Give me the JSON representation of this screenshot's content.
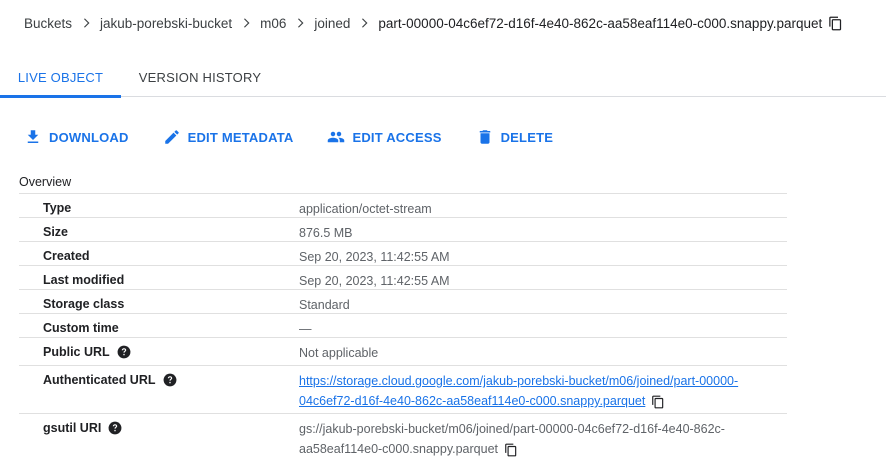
{
  "breadcrumb": {
    "items": [
      "Buckets",
      "jakub-porebski-bucket",
      "m06",
      "joined"
    ],
    "current": "part-00000-04c6ef72-d16f-4e40-862c-aa58eaf114e0-c000.snappy.parquet"
  },
  "tabs": [
    {
      "label": "LIVE OBJECT",
      "active": true
    },
    {
      "label": "VERSION HISTORY",
      "active": false
    }
  ],
  "toolbar": {
    "download": "DOWNLOAD",
    "edit_metadata": "EDIT METADATA",
    "edit_access": "EDIT ACCESS",
    "delete": "DELETE"
  },
  "details": {
    "section": "Overview",
    "type": {
      "label": "Type",
      "value": "application/octet-stream"
    },
    "size": {
      "label": "Size",
      "value": "876.5 MB"
    },
    "created": {
      "label": "Created",
      "value": "Sep 20, 2023, 11:42:55 AM"
    },
    "last_modified": {
      "label": "Last modified",
      "value": "Sep 20, 2023, 11:42:55 AM"
    },
    "storage_class": {
      "label": "Storage class",
      "value": "Standard"
    },
    "custom_time": {
      "label": "Custom time",
      "value": "—"
    },
    "public_url": {
      "label": "Public URL",
      "value": "Not applicable"
    },
    "authenticated_url": {
      "label": "Authenticated URL",
      "line1": "https://storage.cloud.google.com/jakub-porebski-bucket/m06/joined/part-00000-",
      "line2": "04c6ef72-d16f-4e40-862c-aa58eaf114e0-c000.snappy.parquet"
    },
    "gsutil_uri": {
      "label": "gsutil URI",
      "line1": "gs://jakub-porebski-bucket/m06/joined/part-00000-04c6ef72-d16f-4e40-862c-",
      "line2": "aa58eaf114e0-c000.snappy.parquet"
    }
  },
  "colors": {
    "accent": "#1a73e8",
    "text": "#202124",
    "muted": "#5f6368",
    "divider": "#e0e0e0"
  }
}
